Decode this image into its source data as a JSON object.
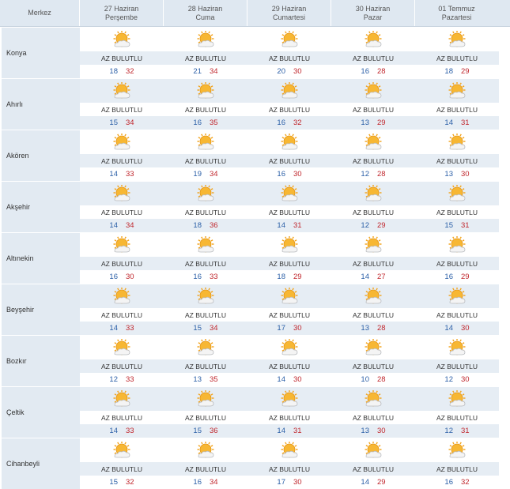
{
  "header": {
    "station_label": "Merkez",
    "days": [
      {
        "date": "27 Haziran",
        "weekday": "Perşembe"
      },
      {
        "date": "28 Haziran",
        "weekday": "Cuma"
      },
      {
        "date": "29 Haziran",
        "weekday": "Cumartesi"
      },
      {
        "date": "30 Haziran",
        "weekday": "Pazar"
      },
      {
        "date": "01 Temmuz",
        "weekday": "Pazartesi"
      }
    ]
  },
  "icon": "partly-cloudy-sun-icon",
  "colors": {
    "min": "#2b5fa7",
    "max": "#c0272d",
    "header_bg": "#dfe8f1"
  },
  "rows": [
    {
      "name": "Konya",
      "days": [
        {
          "desc": "AZ BULUTLU",
          "min": "18",
          "max": "32"
        },
        {
          "desc": "AZ BULUTLU",
          "min": "21",
          "max": "34"
        },
        {
          "desc": "AZ BULUTLU",
          "min": "20",
          "max": "30"
        },
        {
          "desc": "AZ BULUTLU",
          "min": "16",
          "max": "28"
        },
        {
          "desc": "AZ BULUTLU",
          "min": "18",
          "max": "29"
        }
      ]
    },
    {
      "name": "Ahırlı",
      "days": [
        {
          "desc": "AZ BULUTLU",
          "min": "15",
          "max": "34"
        },
        {
          "desc": "AZ BULUTLU",
          "min": "16",
          "max": "35"
        },
        {
          "desc": "AZ BULUTLU",
          "min": "16",
          "max": "32"
        },
        {
          "desc": "AZ BULUTLU",
          "min": "13",
          "max": "29"
        },
        {
          "desc": "AZ BULUTLU",
          "min": "14",
          "max": "31"
        }
      ]
    },
    {
      "name": "Akören",
      "days": [
        {
          "desc": "AZ BULUTLU",
          "min": "14",
          "max": "33"
        },
        {
          "desc": "AZ BULUTLU",
          "min": "19",
          "max": "34"
        },
        {
          "desc": "AZ BULUTLU",
          "min": "16",
          "max": "30"
        },
        {
          "desc": "AZ BULUTLU",
          "min": "12",
          "max": "28"
        },
        {
          "desc": "AZ BULUTLU",
          "min": "13",
          "max": "30"
        }
      ]
    },
    {
      "name": "Akşehir",
      "days": [
        {
          "desc": "AZ BULUTLU",
          "min": "14",
          "max": "34"
        },
        {
          "desc": "AZ BULUTLU",
          "min": "18",
          "max": "36"
        },
        {
          "desc": "AZ BULUTLU",
          "min": "14",
          "max": "31"
        },
        {
          "desc": "AZ BULUTLU",
          "min": "12",
          "max": "29"
        },
        {
          "desc": "AZ BULUTLU",
          "min": "15",
          "max": "31"
        }
      ]
    },
    {
      "name": "Altınekin",
      "days": [
        {
          "desc": "AZ BULUTLU",
          "min": "16",
          "max": "30"
        },
        {
          "desc": "AZ BULUTLU",
          "min": "16",
          "max": "33"
        },
        {
          "desc": "AZ BULUTLU",
          "min": "18",
          "max": "29"
        },
        {
          "desc": "AZ BULUTLU",
          "min": "14",
          "max": "27"
        },
        {
          "desc": "AZ BULUTLU",
          "min": "16",
          "max": "29"
        }
      ]
    },
    {
      "name": "Beyşehir",
      "days": [
        {
          "desc": "AZ BULUTLU",
          "min": "14",
          "max": "33"
        },
        {
          "desc": "AZ BULUTLU",
          "min": "15",
          "max": "34"
        },
        {
          "desc": "AZ BULUTLU",
          "min": "17",
          "max": "30"
        },
        {
          "desc": "AZ BULUTLU",
          "min": "13",
          "max": "28"
        },
        {
          "desc": "AZ BULUTLU",
          "min": "14",
          "max": "30"
        }
      ]
    },
    {
      "name": "Bozkır",
      "days": [
        {
          "desc": "AZ BULUTLU",
          "min": "12",
          "max": "33"
        },
        {
          "desc": "AZ BULUTLU",
          "min": "13",
          "max": "35"
        },
        {
          "desc": "AZ BULUTLU",
          "min": "14",
          "max": "30"
        },
        {
          "desc": "AZ BULUTLU",
          "min": "10",
          "max": "28"
        },
        {
          "desc": "AZ BULUTLU",
          "min": "12",
          "max": "30"
        }
      ]
    },
    {
      "name": "Çeltik",
      "days": [
        {
          "desc": "AZ BULUTLU",
          "min": "14",
          "max": "33"
        },
        {
          "desc": "AZ BULUTLU",
          "min": "15",
          "max": "36"
        },
        {
          "desc": "AZ BULUTLU",
          "min": "14",
          "max": "31"
        },
        {
          "desc": "AZ BULUTLU",
          "min": "13",
          "max": "30"
        },
        {
          "desc": "AZ BULUTLU",
          "min": "12",
          "max": "31"
        }
      ]
    },
    {
      "name": "Cihanbeyli",
      "days": [
        {
          "desc": "AZ BULUTLU",
          "min": "15",
          "max": "32"
        },
        {
          "desc": "AZ BULUTLU",
          "min": "16",
          "max": "34"
        },
        {
          "desc": "AZ BULUTLU",
          "min": "17",
          "max": "30"
        },
        {
          "desc": "AZ BULUTLU",
          "min": "14",
          "max": "29"
        },
        {
          "desc": "AZ BULUTLU",
          "min": "16",
          "max": "32"
        }
      ]
    }
  ]
}
